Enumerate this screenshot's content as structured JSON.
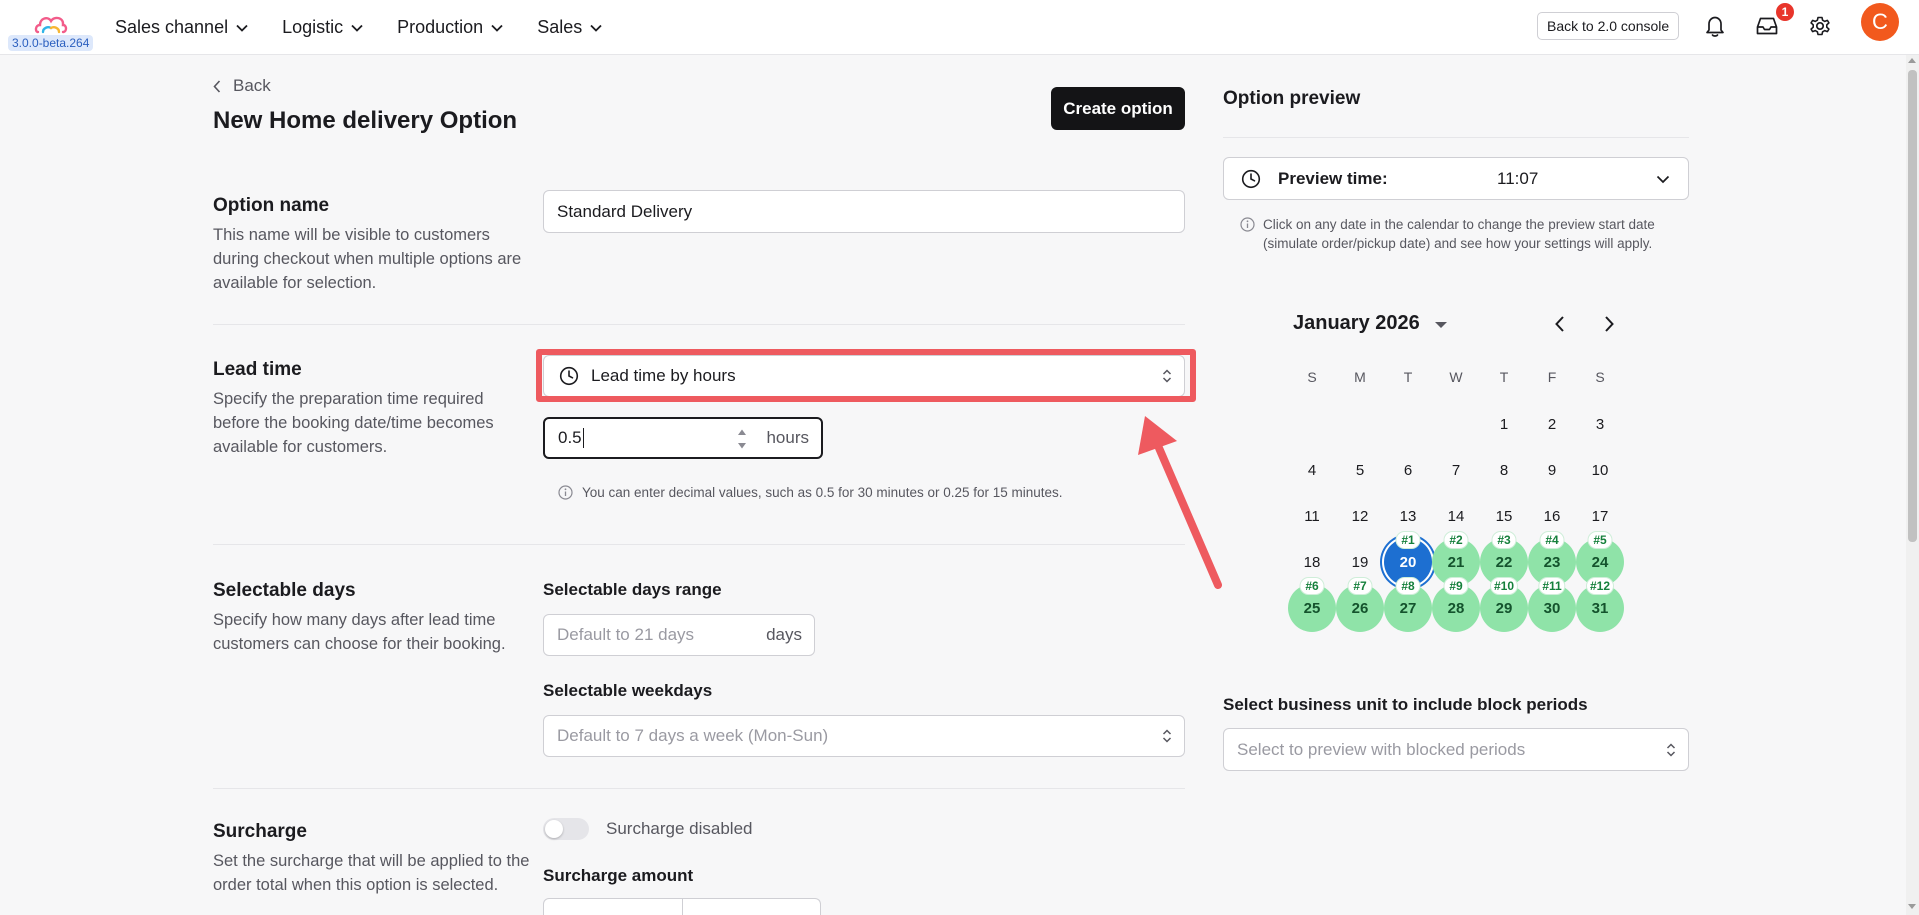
{
  "navbar": {
    "version": "3.0.0-beta.264",
    "menu": [
      {
        "label": "Sales channel"
      },
      {
        "label": "Logistic"
      },
      {
        "label": "Production"
      },
      {
        "label": "Sales"
      }
    ],
    "console_button": "Back to 2.0 console",
    "inbox_badge": "1",
    "avatar_letter": "C"
  },
  "page": {
    "back_label": "Back",
    "title": "New Home delivery Option",
    "create_button": "Create option"
  },
  "option_name": {
    "title": "Option name",
    "description": "This name will be visible to customers during checkout when multiple options are available for selection.",
    "value": "Standard Delivery"
  },
  "lead_time": {
    "title": "Lead time",
    "description": "Specify the preparation time required before the booking date/time becomes available for customers.",
    "mode": "Lead time by hours",
    "hours_value": "0.5",
    "hours_suffix": "hours",
    "hint": "You can enter decimal values, such as 0.5 for 30 minutes or 0.25 for 15 minutes."
  },
  "selectable_days": {
    "title": "Selectable days",
    "description": "Specify how many days after lead time customers can choose for their booking.",
    "range_label": "Selectable days range",
    "range_placeholder": "Default to 21 days",
    "range_suffix": "days",
    "weekdays_label": "Selectable weekdays",
    "weekdays_placeholder": "Default to 7 days a week (Mon-Sun)"
  },
  "surcharge": {
    "title": "Surcharge",
    "description": "Set the surcharge that will be applied to the order total when this option is selected.",
    "toggle_label": "Surcharge disabled",
    "amount_label": "Surcharge amount"
  },
  "preview": {
    "title": "Option preview",
    "time_label": "Preview time:",
    "time_value": "11:07",
    "note": "Click on any date in the calendar to change the preview start date (simulate order/pickup date) and see how your settings will apply.",
    "calendar": {
      "month_label": "January 2026",
      "weekdays": [
        "S",
        "M",
        "T",
        "W",
        "T",
        "F",
        "S"
      ],
      "first_weekday": 4,
      "days_in_month": 31,
      "selected_day": 20,
      "available": [
        {
          "day": 20,
          "tag": "#1"
        },
        {
          "day": 21,
          "tag": "#2"
        },
        {
          "day": 22,
          "tag": "#3"
        },
        {
          "day": 23,
          "tag": "#4"
        },
        {
          "day": 24,
          "tag": "#5"
        },
        {
          "day": 25,
          "tag": "#6"
        },
        {
          "day": 26,
          "tag": "#7"
        },
        {
          "day": 27,
          "tag": "#8"
        },
        {
          "day": 28,
          "tag": "#9"
        },
        {
          "day": 29,
          "tag": "#10"
        },
        {
          "day": 30,
          "tag": "#11"
        },
        {
          "day": 31,
          "tag": "#12"
        }
      ]
    },
    "business_unit_label": "Select business unit to include block periods",
    "business_unit_placeholder": "Select to preview with blocked periods"
  },
  "colors": {
    "accent": "#1d6fd1",
    "available": "#8fe3a8",
    "highlight": "#ee5a5f",
    "primary_button": "#141416",
    "avatar": "#f2591d",
    "badge": "#e8352b"
  }
}
